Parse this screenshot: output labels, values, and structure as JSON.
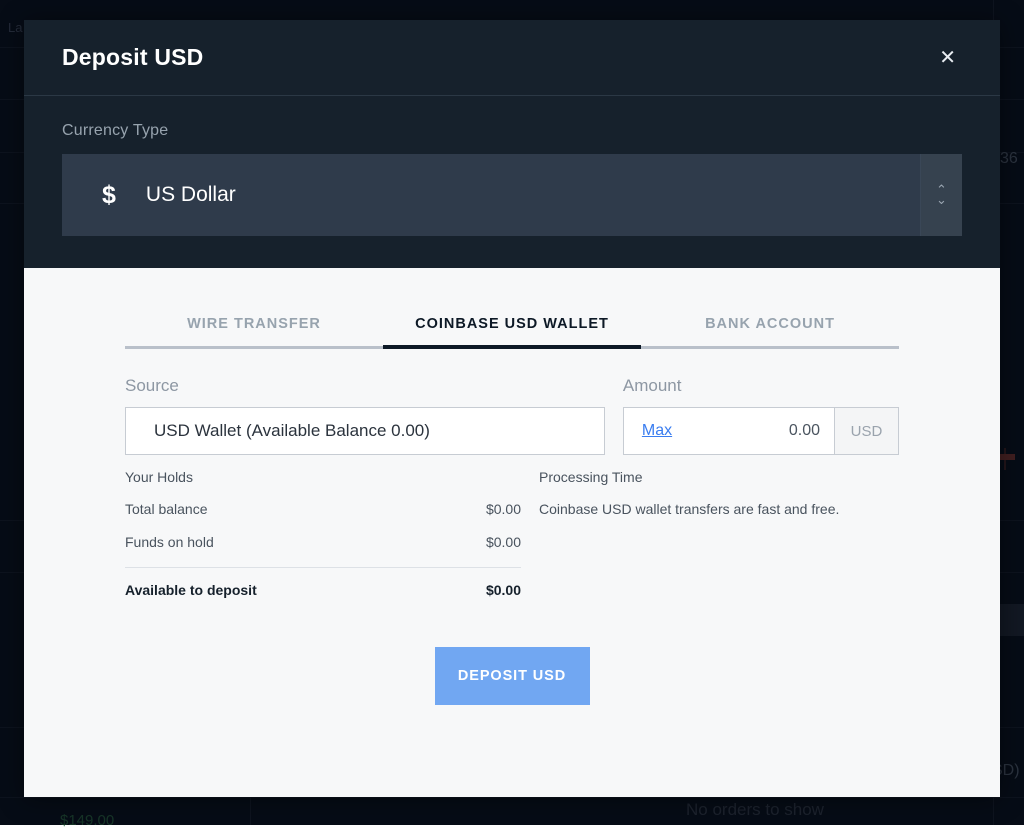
{
  "background": {
    "label_last": "La",
    "price_axis_value": "36",
    "pair_label_fragment": "SD)",
    "orders_empty": "No orders to show",
    "price_green": "$149.00"
  },
  "modal": {
    "title": "Deposit USD",
    "close_icon": "close-icon",
    "currency": {
      "label": "Currency Type",
      "symbol": "$",
      "selected": "US Dollar",
      "chevron_icon": "chevron-up-down-icon"
    },
    "tabs": [
      {
        "label": "WIRE TRANSFER",
        "active": false
      },
      {
        "label": "COINBASE USD WALLET",
        "active": true
      },
      {
        "label": "BANK ACCOUNT",
        "active": false
      }
    ],
    "source": {
      "label": "Source",
      "value": "USD Wallet (Available Balance 0.00)"
    },
    "amount": {
      "label": "Amount",
      "max_label": "Max",
      "value": "0.00",
      "placeholder": "0.00",
      "currency_suffix": "USD"
    },
    "holds": {
      "title": "Your Holds",
      "rows": [
        {
          "label": "Total balance",
          "value": "$0.00"
        },
        {
          "label": "Funds on hold",
          "value": "$0.00"
        }
      ],
      "total": {
        "label": "Available to deposit",
        "value": "$0.00"
      }
    },
    "processing": {
      "title": "Processing Time",
      "text": "Coinbase USD wallet transfers are fast and free."
    },
    "submit_label": "DEPOSIT USD"
  },
  "colors": {
    "header_bg": "#16212c",
    "body_bg": "#f7f8f9",
    "accent_button": "#71a7f2",
    "link": "#3a7df0",
    "select_bg": "#2f3b4b"
  }
}
